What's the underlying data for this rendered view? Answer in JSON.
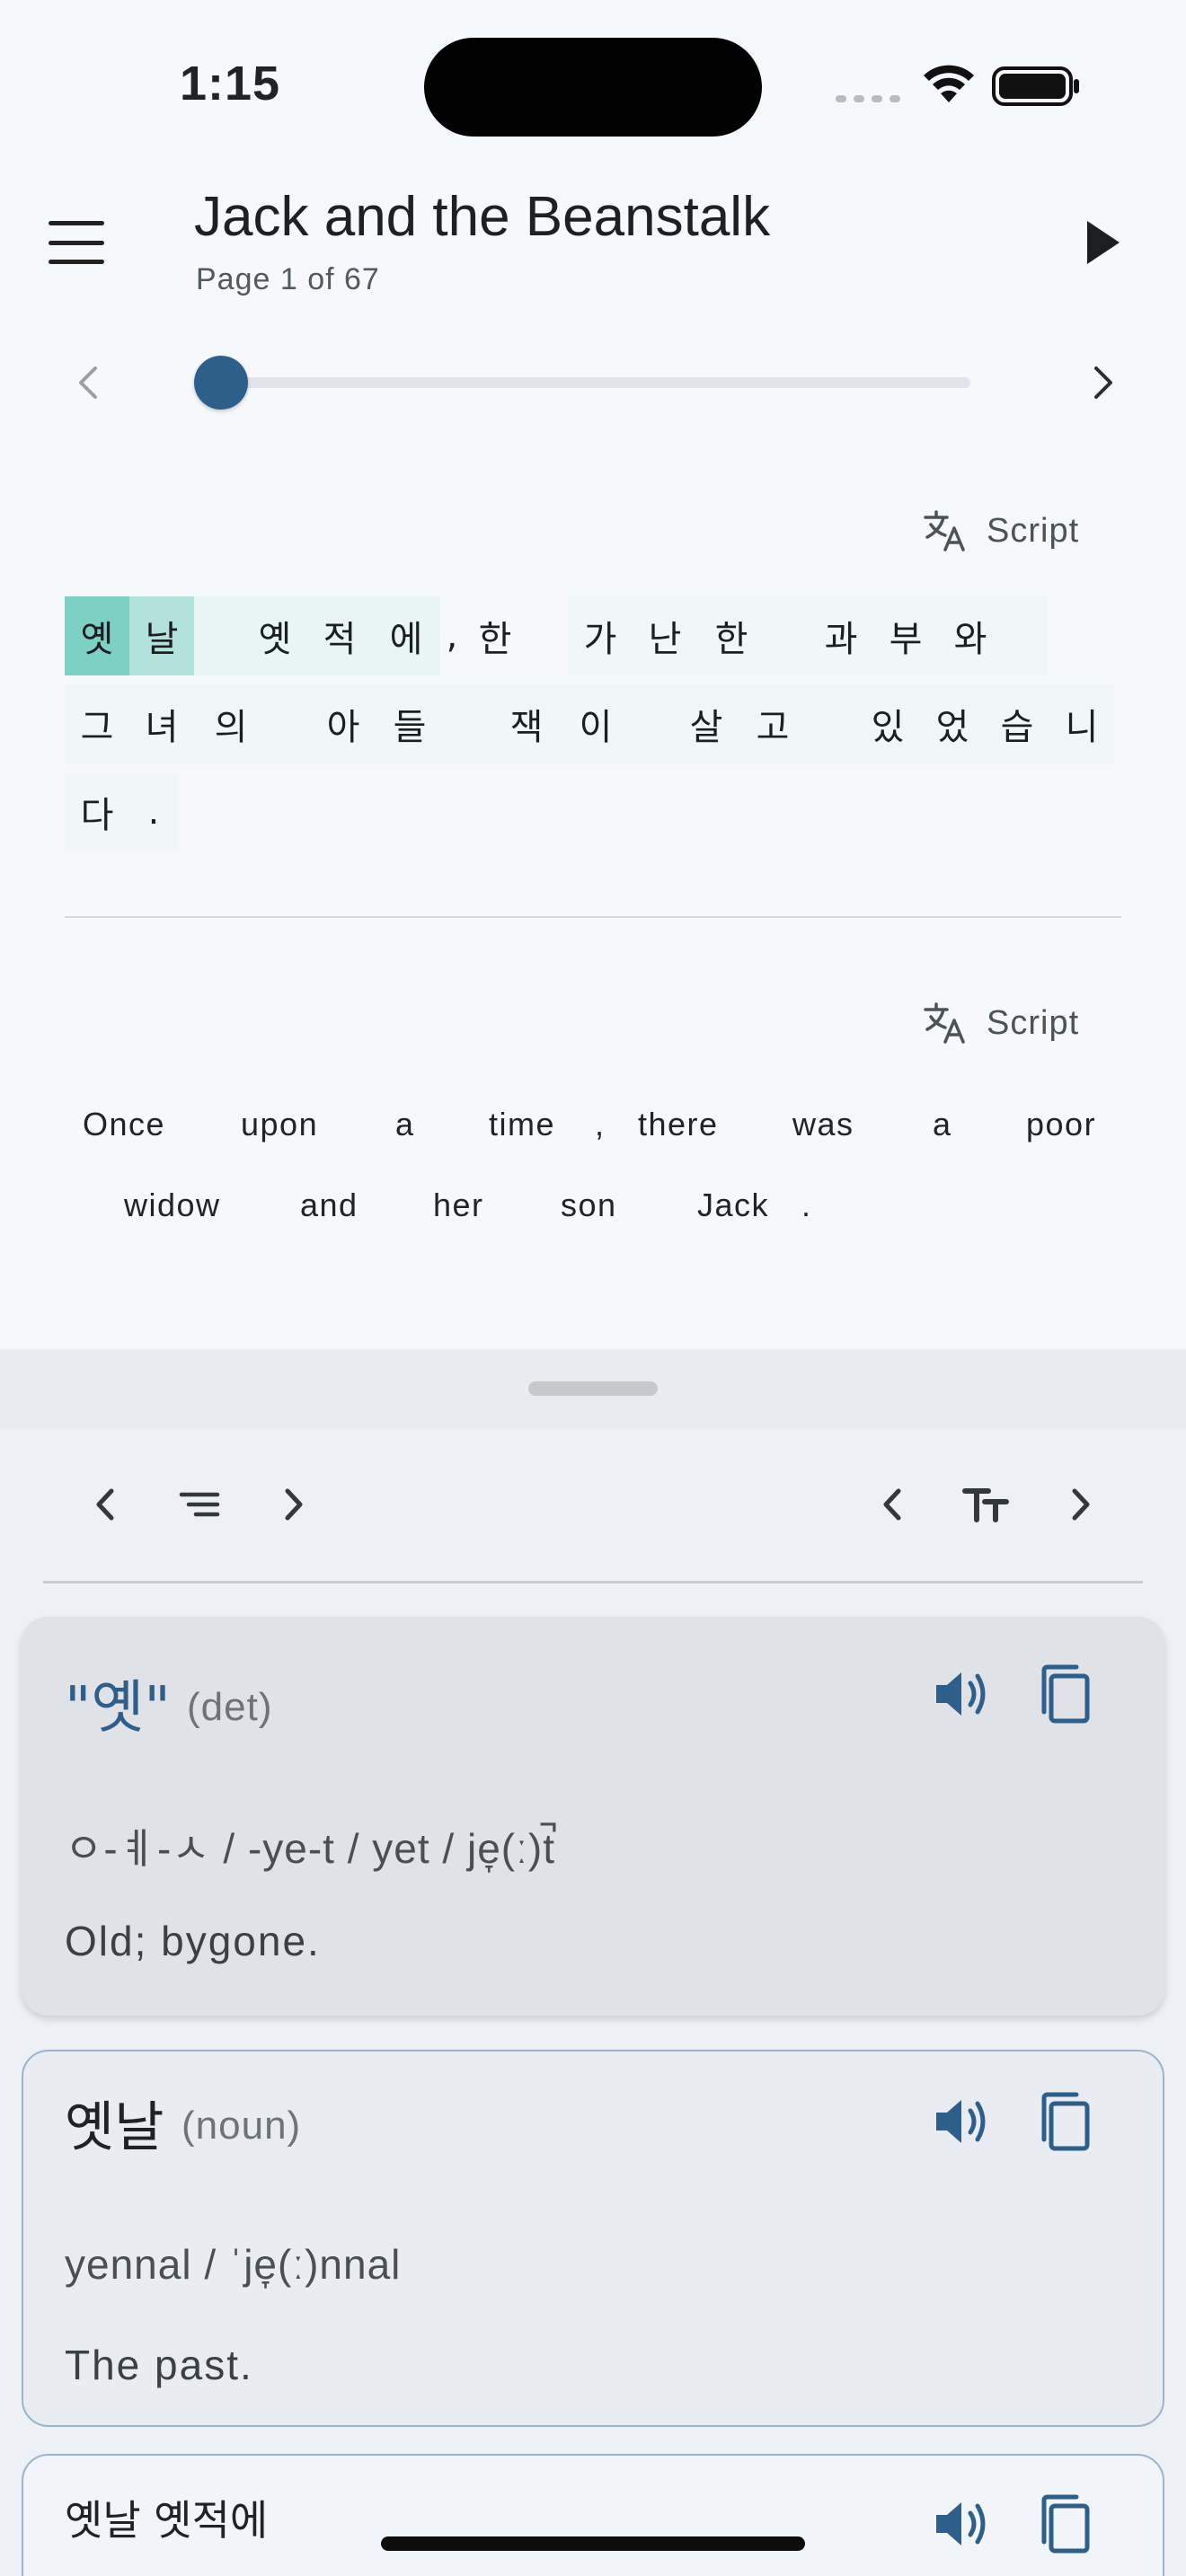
{
  "status_bar": {
    "time": "1:15",
    "icons": [
      "signal-icon",
      "wifi-icon",
      "battery-icon"
    ]
  },
  "header": {
    "title": "Jack and the Beanstalk",
    "page_indicator": "Page 1 of 67",
    "menu_icon": "menu-icon",
    "play_icon": "play-icon"
  },
  "page_slider": {
    "value": 1,
    "min": 1,
    "max": 67
  },
  "script_toggle_label": "Script",
  "korean_text": {
    "lines": [
      [
        {
          "c": "옛",
          "hl": "strong"
        },
        {
          "c": "날",
          "hl": "medium"
        },
        {
          "c": " ",
          "hl": "light"
        },
        {
          "c": "옛",
          "hl": "light"
        },
        {
          "c": "적",
          "hl": "light"
        },
        {
          "c": "에",
          "hl": "light"
        },
        {
          "c": ",",
          "hl": "none"
        },
        {
          "c": "한",
          "hl": "none"
        },
        {
          "c": " ",
          "hl": "none"
        },
        {
          "c": "가",
          "hl": "faint"
        },
        {
          "c": "난",
          "hl": "faint"
        },
        {
          "c": "한",
          "hl": "faint"
        },
        {
          "c": " ",
          "hl": "faint"
        },
        {
          "c": "과",
          "hl": "faint"
        },
        {
          "c": "부",
          "hl": "faint"
        },
        {
          "c": "와",
          "hl": "faint"
        },
        {
          "c": " ",
          "hl": "faint"
        }
      ],
      [
        {
          "c": "그",
          "hl": "faint"
        },
        {
          "c": "녀",
          "hl": "faint"
        },
        {
          "c": "의",
          "hl": "faint"
        },
        {
          "c": " ",
          "hl": "faint"
        },
        {
          "c": "아",
          "hl": "faint"
        },
        {
          "c": "들",
          "hl": "faint"
        },
        {
          "c": " ",
          "hl": "faint"
        },
        {
          "c": "잭",
          "hl": "faint"
        },
        {
          "c": "이",
          "hl": "faint"
        },
        {
          "c": " ",
          "hl": "faint"
        },
        {
          "c": "살",
          "hl": "faint"
        },
        {
          "c": "고",
          "hl": "faint"
        },
        {
          "c": " ",
          "hl": "faint"
        },
        {
          "c": "있",
          "hl": "faint"
        },
        {
          "c": "었",
          "hl": "faint"
        },
        {
          "c": "습",
          "hl": "faint"
        },
        {
          "c": "니",
          "hl": "faint"
        }
      ],
      [
        {
          "c": "다",
          "hl": "faint"
        },
        {
          "c": ".",
          "hl": "faint"
        }
      ]
    ]
  },
  "english_text": {
    "line1": [
      "Once",
      "upon",
      "a",
      "time",
      ",",
      "there",
      "was",
      "a",
      "poor"
    ],
    "line2": [
      "widow",
      "and",
      "her",
      "son",
      "Jack",
      "."
    ]
  },
  "toolbar": {
    "left_icons": [
      "chevron-left-icon",
      "list-icon",
      "chevron-right-icon"
    ],
    "right_icons": [
      "chevron-left-icon",
      "text-size-icon",
      "chevron-right-icon"
    ]
  },
  "cards": [
    {
      "word": "\"옛\"",
      "pos": "(det)",
      "pronunciation": "ㅇ-ㅖ-ㅅ / -ye-t / yet / je̞(ː)t̚",
      "definition": "Old; bygone."
    },
    {
      "word": "옛날",
      "pos": "(noun)",
      "pronunciation": "yennal / ˈje̞(ː)nnal",
      "definition": "The past."
    },
    {
      "word": "옛날 옛적에",
      "pos": "",
      "pronunciation": "",
      "definition": ""
    }
  ],
  "colors": {
    "accent": "#2e5f8a",
    "highlight_strong": "#7ecfc4",
    "highlight_medium": "#b3e1db",
    "highlight_light": "#e8f5f3",
    "highlight_faint": "#f1f7f6"
  }
}
